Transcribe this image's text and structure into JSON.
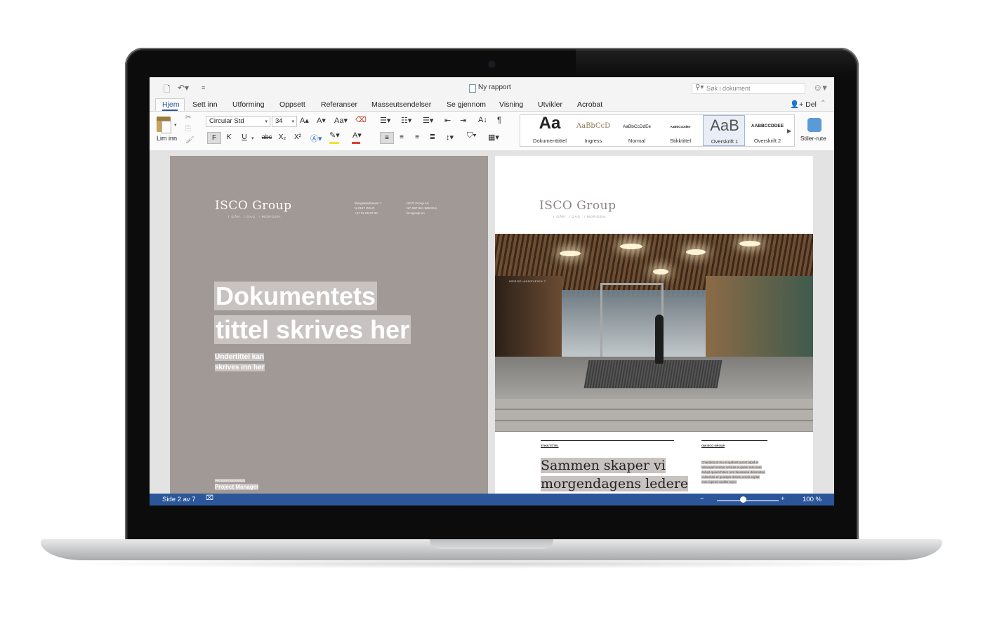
{
  "window": {
    "doc_title": "Ny rapport"
  },
  "search": {
    "placeholder": "Søk i dokument"
  },
  "tabs": [
    "Hjem",
    "Sett inn",
    "Utforming",
    "Oppsett",
    "Referanser",
    "Masseutsendelser",
    "Se gjennom",
    "Visning",
    "Utvikler",
    "Acrobat"
  ],
  "share": {
    "label": "Del"
  },
  "ribbon": {
    "paste_label": "Lim inn",
    "font_name": "Circular Std",
    "font_size": "34",
    "bold": "F",
    "italic": "K",
    "underline": "U",
    "strike": "abc",
    "subscript": "X₂",
    "superscript": "X²",
    "styles": [
      {
        "sample": "Aa",
        "name": "Dokumenttittel"
      },
      {
        "sample": "AaBbCcD",
        "name": "Ingress"
      },
      {
        "sample": "AaBbCcDdEe",
        "name": "Normal"
      },
      {
        "sample": "AaBbCcDdEe",
        "name": "Stikktittel"
      },
      {
        "sample": "AaB",
        "name": "Overskrift 1"
      },
      {
        "sample": "AABBCCDDEE",
        "name": "Overskrift 2"
      }
    ],
    "stiler_label": "Stiler-rute"
  },
  "page_left": {
    "logo": "ISCO Group",
    "tagline": "I GÅR. I DAG. I MORGEN.",
    "address": [
      "Wergelandsveien 7",
      "N-0167 OSLO",
      "+47 22 06 87 00"
    ],
    "company": [
      "ISCO Group AS",
      "NO 967 961 969 MVA",
      "iscogroup.no"
    ],
    "title_line1": "Dokumentets",
    "title_line2": "tittel skrives her",
    "subtitle_line1": "Undertittel kan",
    "subtitle_line2": "skrives inn her",
    "project_label": "PROSJEKTANSVARLIG",
    "project_manager": "Project Manager"
  },
  "page_right": {
    "logo": "ISCO Group",
    "tagline": "I GÅR. I DAG. I MORGEN.",
    "photo_sign": "WERGELANDSVEIEN 7",
    "section_label": "STIKKTITTEL",
    "about_label": "OM ISCO GROUP",
    "quote_line1": "Sammen skaper vi",
    "quote_line2": "morgendagens ledere",
    "body_text": "Chandion et mo et quibust aut et rapid et laborepel molore voloras el quam rem num dolupt quaerchitem rem facearese dolorestuo volorehita et quiaspis dolore aceris explat mos reperet auditis repro"
  },
  "status": {
    "page": "Side 2 av 7",
    "zoom": "100 %",
    "zoom_level_percent": 100
  },
  "colors": {
    "accent": "#2b579a",
    "cover_gray": "#a09995"
  }
}
